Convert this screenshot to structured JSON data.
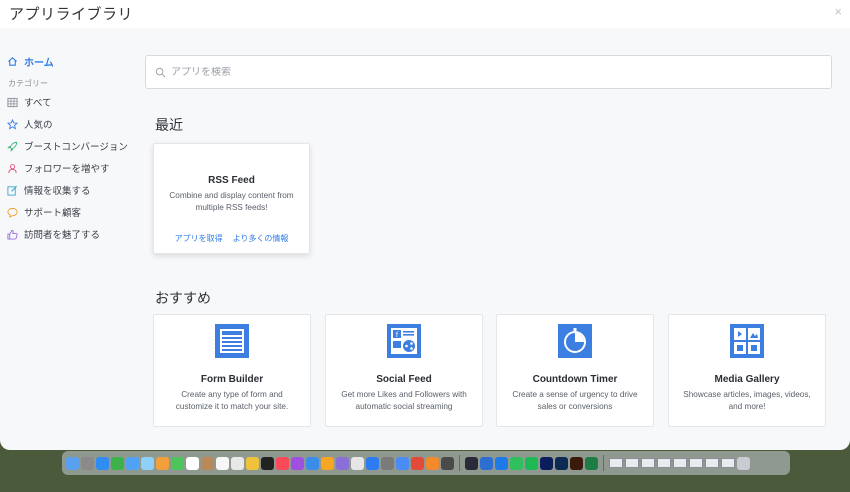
{
  "window": {
    "title": "アプリライブラリ",
    "close_glyph": "×"
  },
  "sidebar": {
    "home": "ホーム",
    "category_label": "カテゴリー",
    "items": [
      {
        "label": "すべて",
        "icon": "grid-icon"
      },
      {
        "label": "人気の",
        "icon": "star-icon"
      },
      {
        "label": "ブーストコンバージョン",
        "icon": "rocket-icon"
      },
      {
        "label": "フォロワーを増やす",
        "icon": "user-icon"
      },
      {
        "label": "情報を収集する",
        "icon": "edit-icon"
      },
      {
        "label": "サポート顧客",
        "icon": "chat-icon"
      },
      {
        "label": "訪問者を魅了する",
        "icon": "thumbs-up-icon"
      }
    ]
  },
  "search": {
    "placeholder": "アプリを検索"
  },
  "recent": {
    "title": "最近",
    "card": {
      "name": "RSS Feed",
      "desc": "Combine and display content from multiple RSS feeds!",
      "get_app": "アプリを取得",
      "more_info": "より多くの情報"
    }
  },
  "recommended": {
    "title": "おすすめ",
    "cards": [
      {
        "name": "Form Builder",
        "desc": "Create any type of form and customize it to match your site.",
        "icon": "form-builder-icon"
      },
      {
        "name": "Social Feed",
        "desc": "Get more Likes and Followers with automatic social streaming",
        "icon": "social-feed-icon"
      },
      {
        "name": "Countdown Timer",
        "desc": "Create a sense of urgency to drive sales or conversions",
        "icon": "countdown-timer-icon"
      },
      {
        "name": "Media Gallery",
        "desc": "Showcase articles, images, videos, and more!",
        "icon": "media-gallery-icon"
      }
    ]
  },
  "colors": {
    "accent": "#2e7be6",
    "icon_blue": "#3d7fe0"
  },
  "dock": {
    "apps": [
      "#5aa0f0",
      "#8a8a8a",
      "#2f8cf2",
      "#3cb34a",
      "#4fa3f7",
      "#8ed0f7",
      "#f2a03c",
      "#4dc45c",
      "#ffffff",
      "#b8895a",
      "#f7f7f7",
      "#e8e8e8",
      "#f0c23c",
      "#222222",
      "#fa4a5a",
      "#a050e0",
      "#3a8de8",
      "#f5a623",
      "#8a6fd8",
      "#e6e6e6",
      "#2d7cf2",
      "#7b7b7b",
      "#4a8cf5",
      "#e24b3a",
      "#f58a2a",
      "#4a4a4a"
    ],
    "apps2": [
      "#2a2a3a",
      "#2c6fd1",
      "#1e7ae6",
      "#2fbf5c",
      "#1db954",
      "#0b1e5c",
      "#0d2a52",
      "#3a1a0a",
      "#1e7d44"
    ]
  }
}
